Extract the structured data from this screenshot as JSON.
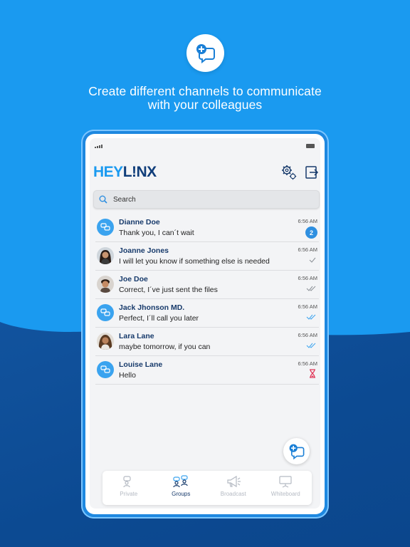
{
  "colors": {
    "sky_blue": "#1a9af0",
    "navy": "#0f4f9a",
    "text_dark_blue": "#173a6b",
    "badge_blue": "#2e8fe0",
    "pending_red": "#e0395a",
    "read_blue": "#3aa3ef"
  },
  "headline": {
    "line1": "Create different channels to communicate",
    "line2": "with your colleagues"
  },
  "app": {
    "logo_part1": "HEY",
    "logo_part2": "L!NX"
  },
  "search": {
    "placeholder": "Search"
  },
  "chats": [
    {
      "name": "Dianne Doe",
      "message": "Thank you, I can´t wait",
      "time": "6:56 AM",
      "avatar": "group-icon",
      "status": "unread",
      "unread_count": "2"
    },
    {
      "name": "Joanne Jones",
      "message": "I will let you know if something else is needed",
      "time": "6:56 AM",
      "avatar": "photo",
      "status": "sent"
    },
    {
      "name": "Joe Doe",
      "message": "Correct, I´ve just sent the files",
      "time": "6:56 AM",
      "avatar": "photo",
      "status": "delivered"
    },
    {
      "name": "Jack Jhonson MD.",
      "message": "Perfect, I´ll call you later",
      "time": "6:56 AM",
      "avatar": "group-icon",
      "status": "read"
    },
    {
      "name": "Lara Lane",
      "message": "maybe tomorrow, if you can",
      "time": "6:56 AM",
      "avatar": "photo",
      "status": "read"
    },
    {
      "name": "Louise Lane",
      "message": "Hello",
      "time": "6:56 AM",
      "avatar": "group-icon",
      "status": "pending"
    }
  ],
  "tabs": [
    {
      "label": "Private",
      "icon": "private-chat-icon",
      "active": false
    },
    {
      "label": "Groups",
      "icon": "groups-icon",
      "active": true
    },
    {
      "label": "Broadcast",
      "icon": "megaphone-icon",
      "active": false
    },
    {
      "label": "Whiteboard",
      "icon": "whiteboard-icon",
      "active": false
    }
  ]
}
